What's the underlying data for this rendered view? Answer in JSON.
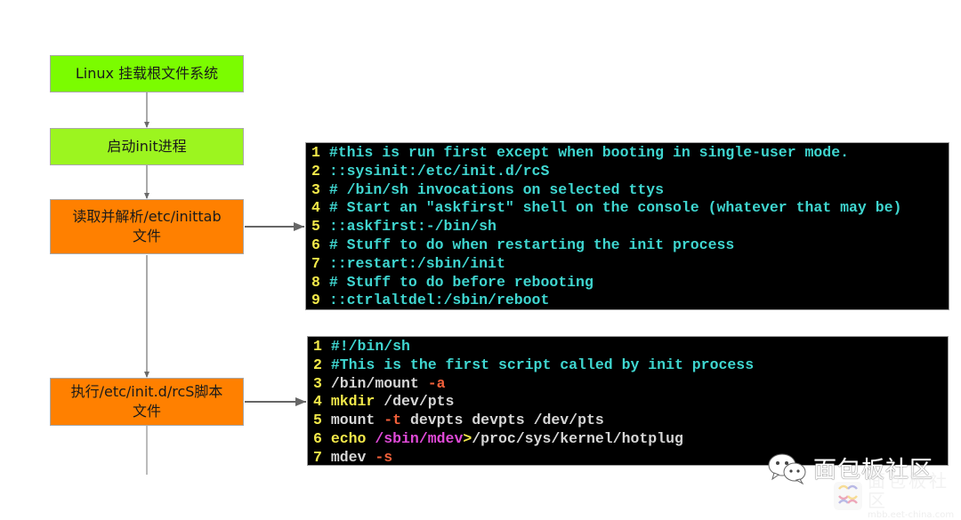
{
  "flow": {
    "steps": [
      {
        "lines": [
          "Linux 挂载根文件系统"
        ],
        "color": "#7bfc00"
      },
      {
        "lines": [
          "启动init进程"
        ],
        "color": "#9cf51f"
      },
      {
        "lines": [
          "读取并解析/etc/inittab",
          "文件"
        ],
        "color": "#ff8000"
      },
      {
        "lines": [
          "执行/etc/init.d/rcS脚本",
          "文件"
        ],
        "color": "#ff8000"
      }
    ]
  },
  "inittab": {
    "lines": [
      {
        "n": "1",
        "segments": [
          {
            "t": "#this is run first except when booting in single-user mode.",
            "c": "cy"
          }
        ]
      },
      {
        "n": "2",
        "segments": [
          {
            "t": "::sysinit:/etc/init.d/rcS",
            "c": "cy"
          }
        ]
      },
      {
        "n": "3",
        "segments": [
          {
            "t": "# /bin/sh invocations on selected ttys",
            "c": "cy"
          }
        ]
      },
      {
        "n": "4",
        "segments": [
          {
            "t": "# Start an \"askfirst\" shell on the console (whatever that may be)",
            "c": "cy"
          }
        ]
      },
      {
        "n": "5",
        "segments": [
          {
            "t": "::askfirst:-/bin/sh",
            "c": "cy"
          }
        ]
      },
      {
        "n": "6",
        "segments": [
          {
            "t": "# Stuff to do when restarting the init process",
            "c": "cy"
          }
        ]
      },
      {
        "n": "7",
        "segments": [
          {
            "t": "::restart:/sbin/init",
            "c": "cy"
          }
        ]
      },
      {
        "n": "8",
        "segments": [
          {
            "t": "# Stuff to do before rebooting",
            "c": "cy"
          }
        ]
      },
      {
        "n": "9",
        "segments": [
          {
            "t": "::ctrlaltdel:/sbin/reboot",
            "c": "cy"
          }
        ]
      }
    ]
  },
  "rcs": {
    "lines": [
      {
        "n": "1",
        "segments": [
          {
            "t": "#!/bin/sh",
            "c": "cy"
          }
        ]
      },
      {
        "n": "2",
        "segments": [
          {
            "t": "#This is the first script called by init process",
            "c": "cy"
          }
        ]
      },
      {
        "n": "3",
        "segments": [
          {
            "t": "/bin/mount ",
            "c": "wh"
          },
          {
            "t": "-a",
            "c": "rd"
          }
        ]
      },
      {
        "n": "4",
        "segments": [
          {
            "t": "mkdir",
            "c": "yl"
          },
          {
            "t": " /dev/pts",
            "c": "wh"
          }
        ]
      },
      {
        "n": "5",
        "segments": [
          {
            "t": "mount ",
            "c": "wh"
          },
          {
            "t": "-t",
            "c": "rd"
          },
          {
            "t": " devpts devpts /dev/pts",
            "c": "wh"
          }
        ]
      },
      {
        "n": "6",
        "segments": [
          {
            "t": "echo",
            "c": "yl"
          },
          {
            "t": " /sbin/mdev",
            "c": "mg"
          },
          {
            "t": ">",
            "c": "yl"
          },
          {
            "t": "/proc/sys/kernel/hotplug",
            "c": "wh"
          }
        ]
      },
      {
        "n": "7",
        "segments": [
          {
            "t": "mdev ",
            "c": "wh"
          },
          {
            "t": "-s",
            "c": "rd"
          }
        ]
      }
    ]
  },
  "watermark": {
    "wechat_name": "面包板社区",
    "site_name": "面包板社区",
    "site_url": "mbb.eet-china.com"
  }
}
